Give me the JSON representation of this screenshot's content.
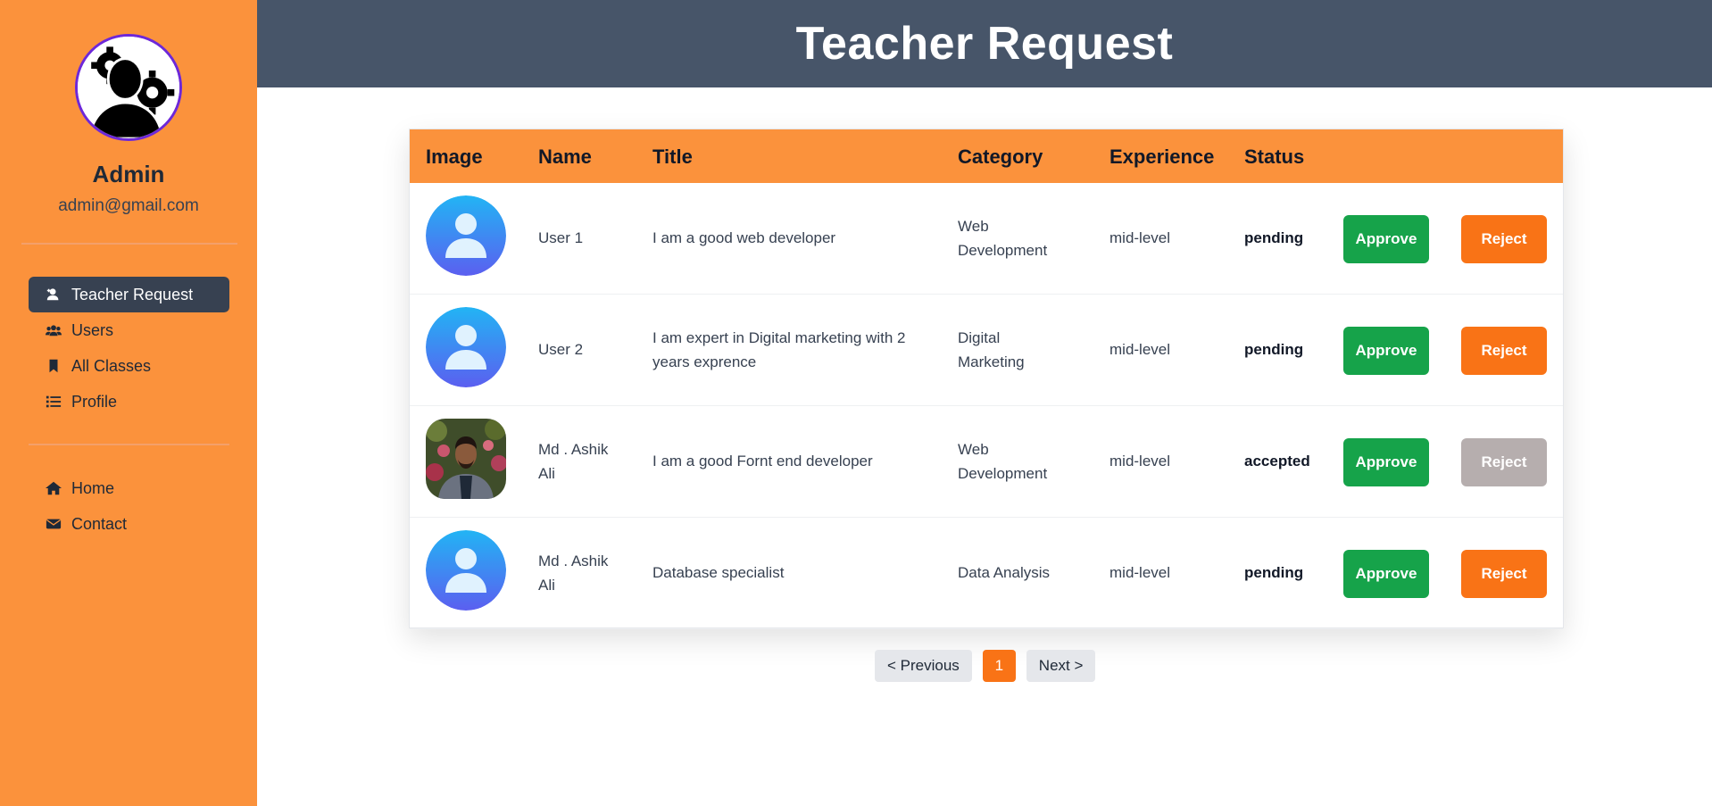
{
  "sidebar": {
    "admin_name": "Admin",
    "admin_email": "admin@gmail.com",
    "nav_primary": [
      {
        "label": "Teacher Request",
        "icon": "user-plus-icon",
        "active": true
      },
      {
        "label": "Users",
        "icon": "users-icon",
        "active": false
      },
      {
        "label": "All Classes",
        "icon": "bookmark-icon",
        "active": false
      },
      {
        "label": "Profile",
        "icon": "list-icon",
        "active": false
      }
    ],
    "nav_secondary": [
      {
        "label": "Home",
        "icon": "home-icon"
      },
      {
        "label": "Contact",
        "icon": "envelope-icon"
      }
    ]
  },
  "header": {
    "title": "Teacher Request"
  },
  "table": {
    "columns": [
      "Image",
      "Name",
      "Title",
      "Category",
      "Experience",
      "Status"
    ],
    "rows": [
      {
        "name": "User 1",
        "title": "I am a good web developer",
        "category": "Web Development",
        "experience": "mid-level",
        "status": "pending",
        "approve": "Approve",
        "reject": "Reject",
        "image": "default-avatar",
        "reject_disabled": false
      },
      {
        "name": "User 2",
        "title": "I am expert in Digital marketing with 2 years exprence",
        "category": "Digital Marketing",
        "experience": "mid-level",
        "status": "pending",
        "approve": "Approve",
        "reject": "Reject",
        "image": "default-avatar",
        "reject_disabled": false
      },
      {
        "name": "Md . Ashik Ali",
        "title": "I am a good Fornt end developer",
        "category": "Web Development",
        "experience": "mid-level",
        "status": "accepted",
        "approve": "Approve",
        "reject": "Reject",
        "image": "photo",
        "reject_disabled": true
      },
      {
        "name": "Md . Ashik Ali",
        "title": "Database specialist",
        "category": "Data Analysis",
        "experience": "mid-level",
        "status": "pending",
        "approve": "Approve",
        "reject": "Reject",
        "image": "default-avatar",
        "reject_disabled": false
      }
    ]
  },
  "pagination": {
    "previous": "< Previous",
    "current": "1",
    "next": "Next >"
  },
  "colors": {
    "sidebar": "#fb923c",
    "header": "#475569",
    "approve": "#16a34a",
    "reject": "#f97316",
    "reject_disabled": "#b6aeae"
  }
}
